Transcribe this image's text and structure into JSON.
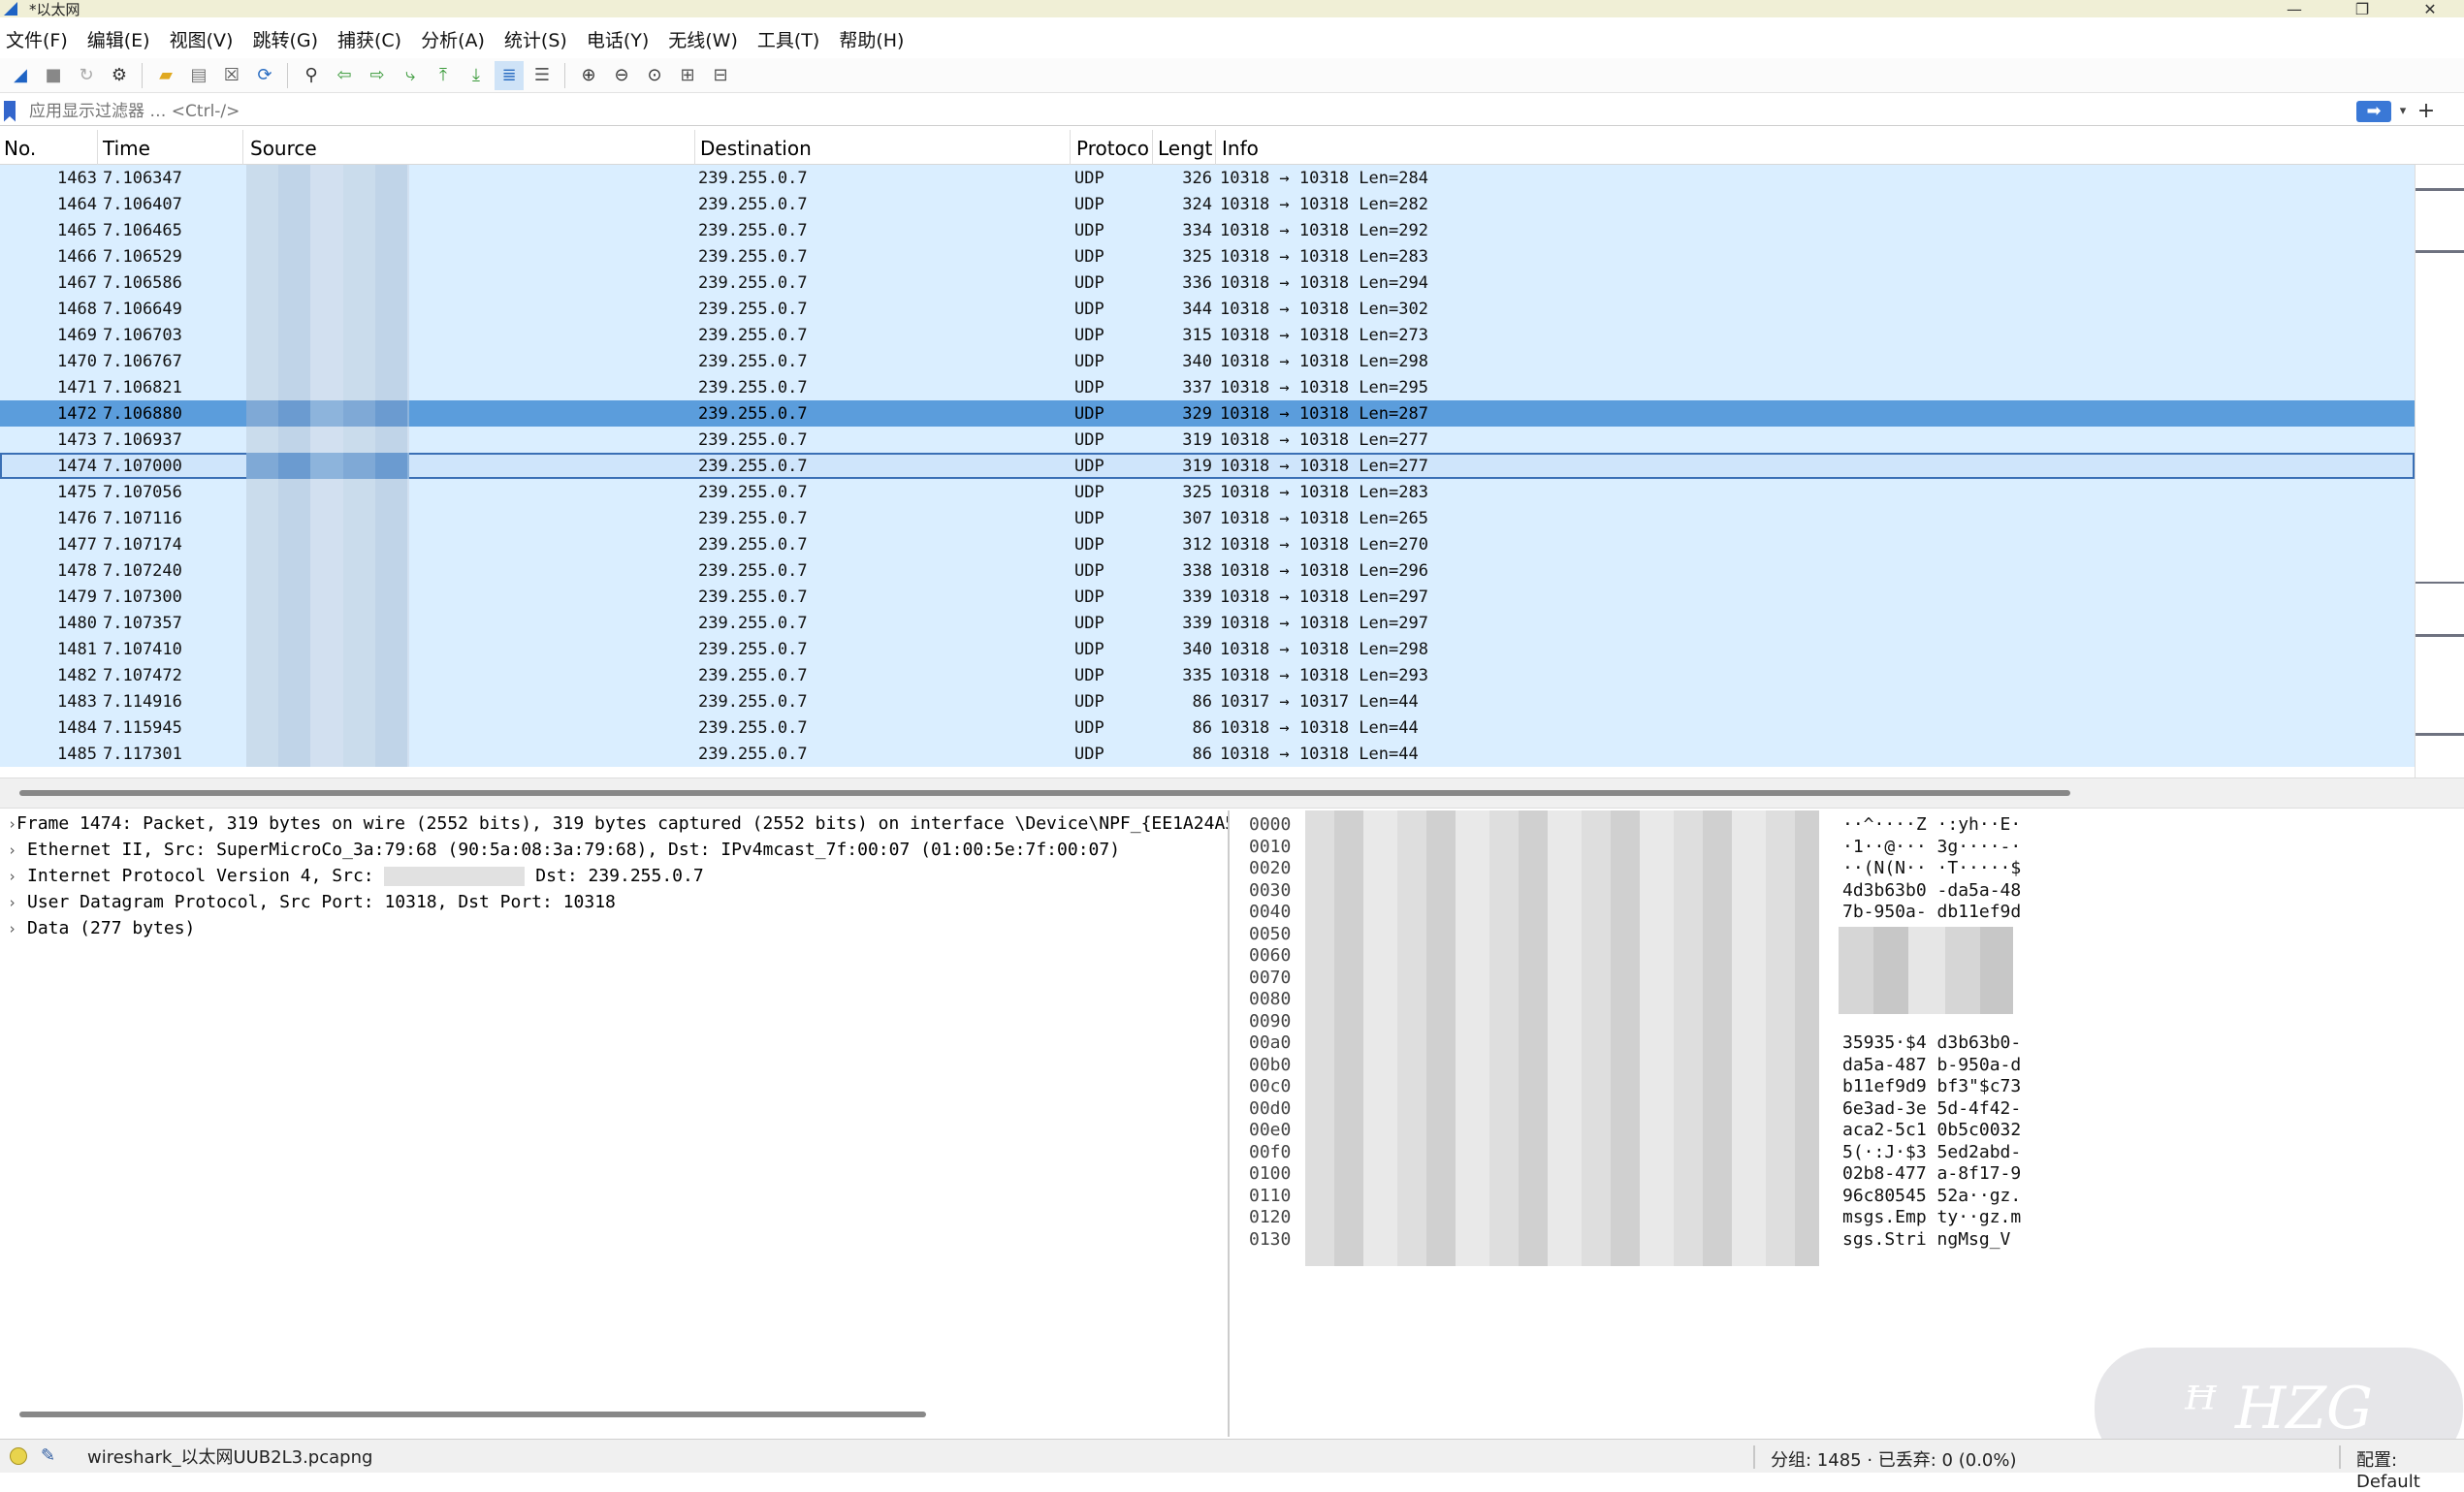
{
  "window": {
    "title": "*以太网",
    "minimize": "—",
    "restore": "❐",
    "close": "✕"
  },
  "menu": [
    "文件(F)",
    "编辑(E)",
    "视图(V)",
    "跳转(G)",
    "捕获(C)",
    "分析(A)",
    "统计(S)",
    "电话(Y)",
    "无线(W)",
    "工具(T)",
    "帮助(H)"
  ],
  "filter": {
    "placeholder": "应用显示过滤器 … <Ctrl-/>",
    "apply_icon": "arrow-right-icon",
    "plus": "+"
  },
  "columns": {
    "no": "No.",
    "time": "Time",
    "source": "Source",
    "destination": "Destination",
    "protocol": "Protoco",
    "length": "Lengt",
    "info": "Info"
  },
  "packets": [
    {
      "no": "1463",
      "time": "7.106347",
      "dst": "239.255.0.7",
      "proto": "UDP",
      "len": "326",
      "info": "10318 → 10318 Len=284"
    },
    {
      "no": "1464",
      "time": "7.106407",
      "dst": "239.255.0.7",
      "proto": "UDP",
      "len": "324",
      "info": "10318 → 10318 Len=282"
    },
    {
      "no": "1465",
      "time": "7.106465",
      "dst": "239.255.0.7",
      "proto": "UDP",
      "len": "334",
      "info": "10318 → 10318 Len=292"
    },
    {
      "no": "1466",
      "time": "7.106529",
      "dst": "239.255.0.7",
      "proto": "UDP",
      "len": "325",
      "info": "10318 → 10318 Len=283"
    },
    {
      "no": "1467",
      "time": "7.106586",
      "dst": "239.255.0.7",
      "proto": "UDP",
      "len": "336",
      "info": "10318 → 10318 Len=294"
    },
    {
      "no": "1468",
      "time": "7.106649",
      "dst": "239.255.0.7",
      "proto": "UDP",
      "len": "344",
      "info": "10318 → 10318 Len=302"
    },
    {
      "no": "1469",
      "time": "7.106703",
      "dst": "239.255.0.7",
      "proto": "UDP",
      "len": "315",
      "info": "10318 → 10318 Len=273"
    },
    {
      "no": "1470",
      "time": "7.106767",
      "dst": "239.255.0.7",
      "proto": "UDP",
      "len": "340",
      "info": "10318 → 10318 Len=298"
    },
    {
      "no": "1471",
      "time": "7.106821",
      "dst": "239.255.0.7",
      "proto": "UDP",
      "len": "337",
      "info": "10318 → 10318 Len=295"
    },
    {
      "no": "1472",
      "time": "7.106880",
      "dst": "239.255.0.7",
      "proto": "UDP",
      "len": "329",
      "info": "10318 → 10318 Len=287"
    },
    {
      "no": "1473",
      "time": "7.106937",
      "dst": "239.255.0.7",
      "proto": "UDP",
      "len": "319",
      "info": "10318 → 10318 Len=277"
    },
    {
      "no": "1474",
      "time": "7.107000",
      "dst": "239.255.0.7",
      "proto": "UDP",
      "len": "319",
      "info": "10318 → 10318 Len=277"
    },
    {
      "no": "1475",
      "time": "7.107056",
      "dst": "239.255.0.7",
      "proto": "UDP",
      "len": "325",
      "info": "10318 → 10318 Len=283"
    },
    {
      "no": "1476",
      "time": "7.107116",
      "dst": "239.255.0.7",
      "proto": "UDP",
      "len": "307",
      "info": "10318 → 10318 Len=265"
    },
    {
      "no": "1477",
      "time": "7.107174",
      "dst": "239.255.0.7",
      "proto": "UDP",
      "len": "312",
      "info": "10318 → 10318 Len=270"
    },
    {
      "no": "1478",
      "time": "7.107240",
      "dst": "239.255.0.7",
      "proto": "UDP",
      "len": "338",
      "info": "10318 → 10318 Len=296"
    },
    {
      "no": "1479",
      "time": "7.107300",
      "dst": "239.255.0.7",
      "proto": "UDP",
      "len": "339",
      "info": "10318 → 10318 Len=297"
    },
    {
      "no": "1480",
      "time": "7.107357",
      "dst": "239.255.0.7",
      "proto": "UDP",
      "len": "339",
      "info": "10318 → 10318 Len=297"
    },
    {
      "no": "1481",
      "time": "7.107410",
      "dst": "239.255.0.7",
      "proto": "UDP",
      "len": "340",
      "info": "10318 → 10318 Len=298"
    },
    {
      "no": "1482",
      "time": "7.107472",
      "dst": "239.255.0.7",
      "proto": "UDP",
      "len": "335",
      "info": "10318 → 10318 Len=293"
    },
    {
      "no": "1483",
      "time": "7.114916",
      "dst": "239.255.0.7",
      "proto": "UDP",
      "len": "86",
      "info": "10317 → 10317 Len=44"
    },
    {
      "no": "1484",
      "time": "7.115945",
      "dst": "239.255.0.7",
      "proto": "UDP",
      "len": "86",
      "info": "10318 → 10318 Len=44"
    },
    {
      "no": "1485",
      "time": "7.117301",
      "dst": "239.255.0.7",
      "proto": "UDP",
      "len": "86",
      "info": "10318 → 10318 Len=44"
    }
  ],
  "selected_no": "1472",
  "current_no": "1474",
  "details": {
    "frame": "Frame 1474: Packet, 319 bytes on wire (2552 bits), 319 bytes captured (2552 bits) on interface \\Device\\NPF_{EE1A24A5",
    "ethernet": "Ethernet II, Src: SuperMicroCo_3a:79:68 (90:5a:08:3a:79:68), Dst: IPv4mcast_7f:00:07 (01:00:5e:7f:00:07)",
    "ip_prefix": "Internet Protocol Version 4, Src: ",
    "ip_suffix": " Dst: 239.255.0.7",
    "udp": "User Datagram Protocol, Src Port: 10318, Dst Port: 10318",
    "data": "Data (277 bytes)"
  },
  "bytes": {
    "offsets": [
      "0000",
      "0010",
      "0020",
      "0030",
      "0040",
      "0050",
      "0060",
      "0070",
      "0080",
      "0090",
      "00a0",
      "00b0",
      "00c0",
      "00d0",
      "00e0",
      "00f0",
      "0100",
      "0110",
      "0120",
      "0130"
    ],
    "ascii": [
      "··^····Z ·:yh··E·",
      "·1··@··· 3g····-·",
      "··(N(N·· ·T·····$",
      "4d3b63b0 -da5a-48",
      "7b-950a- db11ef9d",
      "",
      "",
      "",
      "",
      "",
      "35935·$4 d3b63b0-",
      "da5a-487 b-950a-d",
      "b11ef9d9 bf3\"$c73",
      "6e3ad-3e 5d-4f42-",
      "aca2-5c1 0b5c0032",
      "5(·:J·$3 5ed2abd-",
      "02b8-477 a-8f17-9",
      "96c80545 52a··gz.",
      "msgs.Emp ty··gz.m",
      "sgs.Stri ngMsg_V"
    ]
  },
  "status": {
    "file": "wireshark_以太网UUB2L3.pcapng",
    "packets": "分组: 1485 · 已丢弃: 0 (0.0%)",
    "profile": "配置: Default"
  },
  "watermark": "ꟸ HZG"
}
